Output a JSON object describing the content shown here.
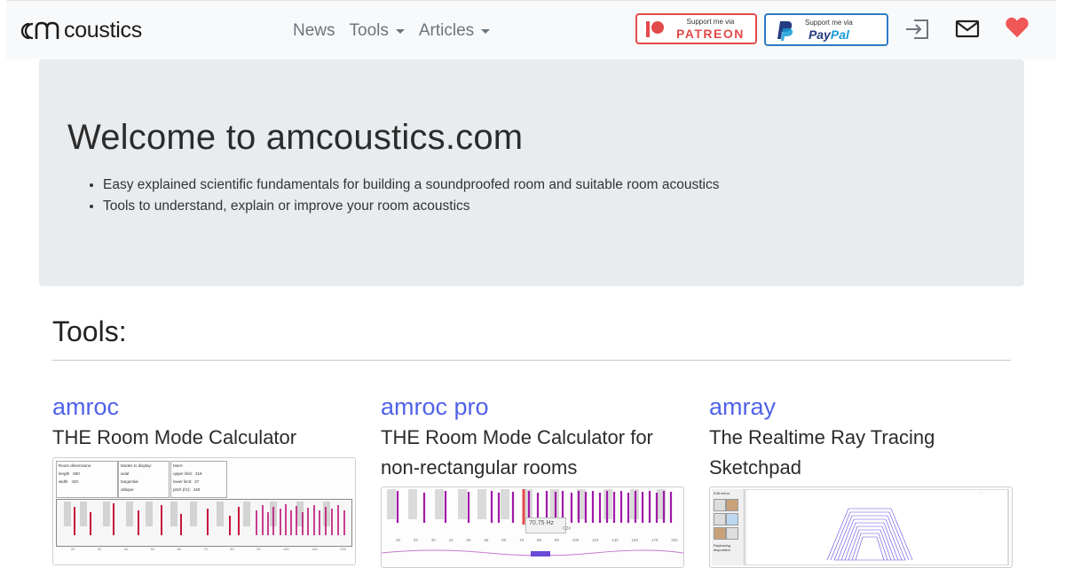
{
  "navbar": {
    "logo_text": "coustics",
    "links": {
      "news": "News",
      "tools": "Tools",
      "articles": "Articles"
    },
    "patreon": {
      "small": "Support me via",
      "big": "PATREON",
      "color": "#e34a4a"
    },
    "paypal": {
      "small": "Support me via",
      "big_a": "Pay",
      "big_b": "Pal",
      "color": "#2d7bc4"
    },
    "icons": [
      "sign-in-icon",
      "mail-icon",
      "heart-icon"
    ]
  },
  "jumbotron": {
    "title": "Welcome to amcoustics.com",
    "bullets": [
      "Easy explained scientific fundamentals for building a soundproofed room and suitable room acoustics",
      "Tools to understand, explain or improve your room acoustics"
    ]
  },
  "tools": {
    "heading": "Tools:",
    "cards": [
      {
        "title": "amroc",
        "description": "THE Room Mode Calculator",
        "thumb": {
          "box1_title": "Room dimensions:",
          "rows": [
            {
              "label": "length",
              "value": "560"
            },
            {
              "label": "width",
              "value": "420"
            },
            {
              "label": "height",
              "value": "300"
            }
          ],
          "box2_title": "Modes to display:",
          "modes": [
            "axial",
            "tangential",
            "oblique"
          ],
          "box3_title": "More:",
          "more": [
            {
              "label": "upper limit:",
              "value": "219"
            },
            {
              "label": "lower limit:",
              "value": "27"
            },
            {
              "label": "pitch (hz):",
              "value": "440"
            }
          ],
          "ticks": [
            "20",
            "30",
            "40",
            "50",
            "60",
            "70",
            "80",
            "90",
            "100",
            "150",
            "200"
          ]
        }
      },
      {
        "title": "amroc pro",
        "description": "THE Room Mode Calculator for non-rectangular rooms",
        "thumb": {
          "tooltip": "70.75 Hz",
          "tooltip_note": "C2#",
          "ticks": [
            "30",
            "32",
            "40",
            "44",
            "50",
            "56",
            "60",
            "70",
            "80",
            "90",
            "100",
            "110",
            "130",
            "150",
            "170",
            "200"
          ]
        }
      },
      {
        "title": "amray",
        "description": "The Realtime Ray Tracing Sketchpad",
        "thumb": {
          "menu_title": "Edit menu",
          "note": "Raytracing disposition"
        }
      }
    ]
  },
  "colors": {
    "link": "#5062e8",
    "heart": "#f05656",
    "jumbotron_bg": "#e9ecef",
    "navbar_bg": "#f8f9fa"
  }
}
